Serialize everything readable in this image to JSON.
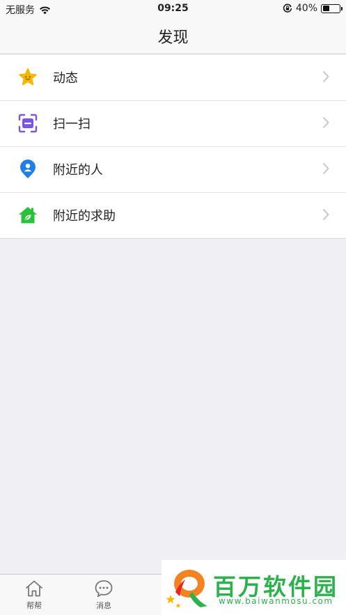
{
  "status_bar": {
    "carrier": "无服务",
    "time": "09:25",
    "battery_percent": "40%",
    "battery_level": 0.4,
    "icons": [
      "wifi-icon",
      "orientation-lock-icon",
      "battery-icon"
    ]
  },
  "nav": {
    "title": "发现"
  },
  "menu": {
    "items": [
      {
        "label": "动态",
        "icon": "star-icon",
        "color": "#f5b800"
      },
      {
        "label": "扫一扫",
        "icon": "scan-icon",
        "color": "#7b57e0"
      },
      {
        "label": "附近的人",
        "icon": "location-person-icon",
        "color": "#1e7fe6"
      },
      {
        "label": "附近的求助",
        "icon": "house-leaf-icon",
        "color": "#2bc23b"
      }
    ]
  },
  "tab_bar": {
    "tabs": [
      {
        "label": "帮帮",
        "icon": "home-icon"
      },
      {
        "label": "消息",
        "icon": "chat-bubble-icon"
      }
    ]
  },
  "watermark": {
    "title": "百万软件园",
    "url": "www.baiwanmosu.com",
    "color": "#2bb24c"
  }
}
